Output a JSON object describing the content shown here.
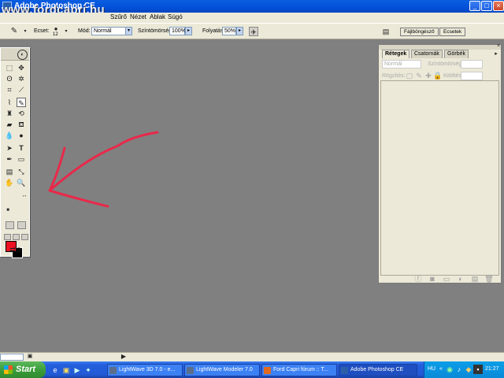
{
  "window": {
    "title": "Adobe Photoshop CE",
    "watermark": "www.fordcapri.hu",
    "buttons": [
      "_",
      "□",
      "×"
    ]
  },
  "menu": [
    "Szűrő",
    "Nézet",
    "Ablak",
    "Súgó"
  ],
  "options": {
    "brush_label": "Ecset:",
    "brush_size": "12",
    "mode_label": "Mód:",
    "mode_value": "Normál",
    "opacity_label": "Színtömörség:",
    "opacity_value": "100%",
    "flow_label": "Folyatás:",
    "flow_value": "50%",
    "well_tabs": [
      "Fájlböngésző",
      "Ecsetek"
    ]
  },
  "toolbox": {
    "foreground_color": "#ee1122",
    "background_color": "#000000"
  },
  "layers_panel": {
    "tabs": [
      "Rétegek",
      "Csatornák",
      "Görbék"
    ],
    "blend_mode": "Normál",
    "opacity_label": "Színtömörség:",
    "lock_label": "Rögzítés:",
    "fill_label": "Kitöltés:"
  },
  "taskbar": {
    "start": "Start",
    "tasks": [
      {
        "label": "LightWave 3D 7.0 - e...",
        "color": "#5a6e8c"
      },
      {
        "label": "LightWave Modeler 7.0",
        "color": "#5a6e8c"
      },
      {
        "label": "Ford Capri fórum :: T...",
        "color": "#e06a20"
      },
      {
        "label": "Adobe Photoshop CE",
        "color": "#2b5fa8"
      }
    ],
    "lang": "HU",
    "clock": "21:27"
  },
  "annotation": {
    "arrow_color": "#e8294a"
  }
}
